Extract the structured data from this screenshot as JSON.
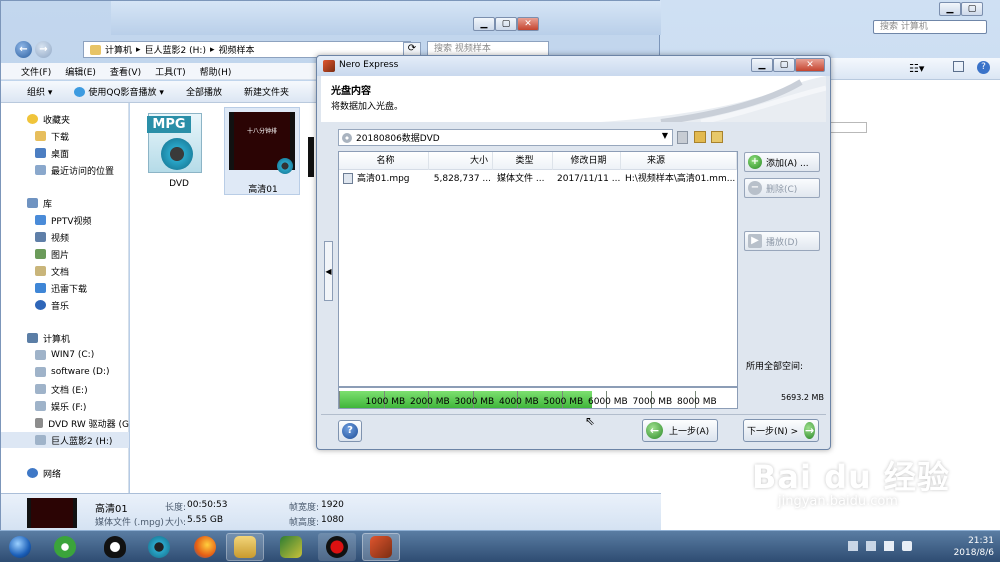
{
  "bg_window": {
    "search_placeholder": "搜索 计算机",
    "search_placeholder2": "视频"
  },
  "explorer": {
    "address": [
      "计算机",
      "巨人蓝影2 (H:)",
      "视频样本"
    ],
    "search_placeholder": "搜索 视频样本",
    "menu": [
      "文件(F)",
      "编辑(E)",
      "查看(V)",
      "工具(T)",
      "帮助(H)"
    ],
    "toolbar": [
      "组织 ▾",
      "使用QQ影音播放 ▾",
      "全部播放",
      "新建文件夹"
    ],
    "nav": {
      "favorites": "收藏夹",
      "fav_items": [
        "下载",
        "桌面",
        "最近访问的位置"
      ],
      "library": "库",
      "lib_items": [
        "PPTV视频",
        "视频",
        "图片",
        "文档",
        "迅雷下载",
        "音乐"
      ],
      "computer": "计算机",
      "drives": [
        "WIN7 (C:)",
        "software (D:)",
        "文档 (E:)",
        "娱乐 (F:)",
        "DVD RW 驱动器 (G",
        "巨人蓝影2 (H:)"
      ],
      "network": "网络"
    },
    "files": [
      {
        "name": "DVD",
        "badge": "MPG"
      },
      {
        "name": "高清01",
        "thumb_text": "十八分钟排"
      }
    ],
    "details": {
      "name": "高清01",
      "type": "媒体文件 (.mpg)",
      "length_label": "长度:",
      "length": "00:50:53",
      "size_label": "大小:",
      "size": "5.55 GB",
      "fw_label": "帧宽度:",
      "frame_width": "1920",
      "fh_label": "帧高度:",
      "frame_height": "1080"
    }
  },
  "nero": {
    "title": "Nero Express",
    "header_title": "光盘内容",
    "header_sub": "将数据加入光盘。",
    "disc_name": "20180806数据DVD",
    "columns": [
      "名称",
      "大小",
      "类型",
      "修改日期",
      "来源"
    ],
    "rows": [
      {
        "name": "高清01.mpg",
        "size": "5,828,737 ...",
        "type": "媒体文件 ...",
        "date": "2017/11/11 ...",
        "source": "H:\\视频样本\\高清01.mm..."
      }
    ],
    "buttons": {
      "add": "添加(A) ...",
      "delete": "删除(C)",
      "play": "播放(D)",
      "back": "上一步(A)",
      "next": "下一步(N) >"
    },
    "capacity": {
      "used_fraction": 0.635,
      "labels": [
        "1000 MB",
        "2000 MB",
        "3000 MB",
        "4000 MB",
        "5000 MB",
        "6000 MB",
        "7000 MB",
        "8000 MB"
      ],
      "total_label": "所用全部空间:",
      "total": "5693.2 MB"
    }
  },
  "taskbar": {
    "time": "21:31",
    "date": "2018/8/6"
  },
  "watermark": "Bai du 经验",
  "watermark_url": "jingyan.baidu.com"
}
